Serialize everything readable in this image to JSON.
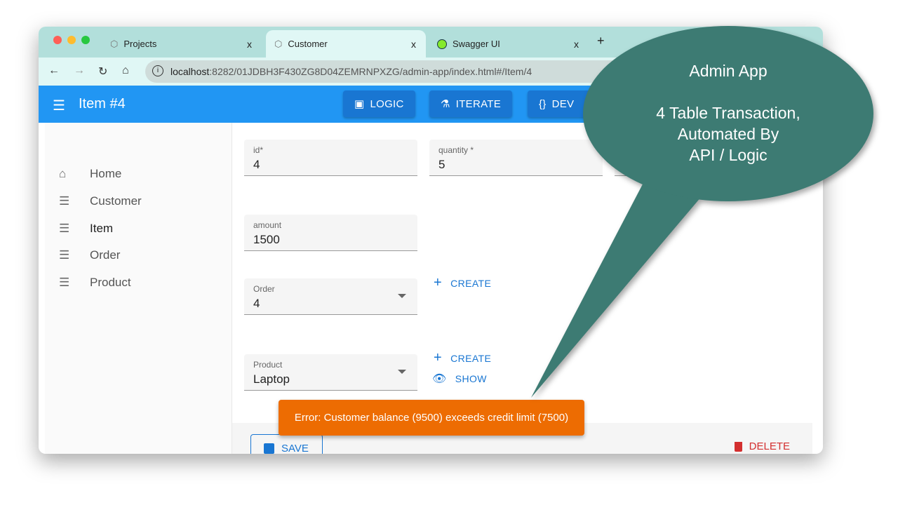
{
  "browser": {
    "tabs": [
      {
        "label": "Projects",
        "icon": "hexagon-icon"
      },
      {
        "label": "Customer",
        "icon": "hexagon-icon",
        "active": true
      },
      {
        "label": "Swagger UI",
        "icon": "swagger-icon"
      }
    ],
    "close_glyph": "x",
    "new_tab": "+",
    "url_host": "localhost",
    "url_rest": ":8282/01JDBH3F430ZG8D04ZEMRNPXZG/admin-app/index.html#/Item/4"
  },
  "appbar": {
    "title": "Item #4",
    "buttons": [
      "LOGIC",
      "ITERATE",
      "DEV"
    ]
  },
  "sidebar": {
    "items": [
      {
        "label": "Home",
        "icon": "home-icon"
      },
      {
        "label": "Customer",
        "icon": "list-icon"
      },
      {
        "label": "Item",
        "icon": "list-icon",
        "active": true
      },
      {
        "label": "Order",
        "icon": "list-icon"
      },
      {
        "label": "Product",
        "icon": "list-icon"
      }
    ]
  },
  "form": {
    "id": {
      "label": "id*",
      "value": "4"
    },
    "quantity": {
      "label": "quantity *",
      "value": "5"
    },
    "amount": {
      "label": "amount",
      "value": "1500"
    },
    "order": {
      "label": "Order",
      "value": "4"
    },
    "product": {
      "label": "Product",
      "value": "Laptop"
    },
    "create_label": "CREATE",
    "show_label": "SHOW"
  },
  "footer": {
    "save": "SAVE",
    "delete": "DELETE"
  },
  "toast": {
    "message": "Error: Customer balance (9500) exceeds credit limit (7500)",
    "color": "#ed6c02"
  },
  "callout": {
    "line1": "Admin App",
    "line2": "4 Table Transaction,",
    "line3": "Automated By",
    "line4": "API / Logic",
    "color": "#3d7b73"
  },
  "colors": {
    "primary": "#2196f3",
    "button": "#1976d2",
    "tabbar": "#b2dfdb"
  }
}
